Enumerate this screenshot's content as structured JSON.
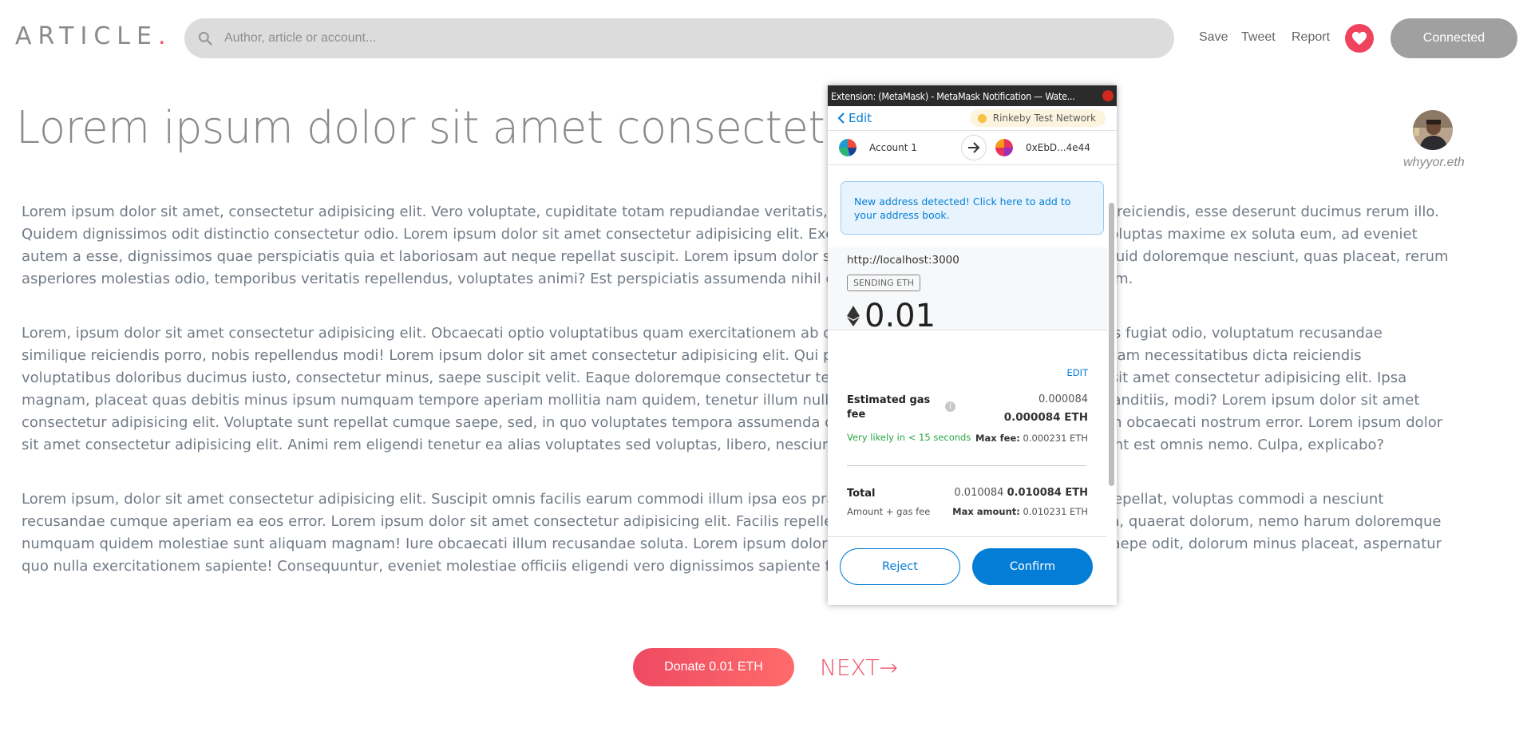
{
  "header": {
    "logo_text": "ARTICLE",
    "logo_dot": ".",
    "search_placeholder": "Author, article or account...",
    "nav": {
      "save": "Save",
      "tweet": "Tweet",
      "report": "Report"
    },
    "connected_label": "Connected"
  },
  "article": {
    "title": "Lorem ipsum dolor sit amet consectetur.",
    "author": "whyyor.eth",
    "paragraphs": [
      "Lorem ipsum dolor sit amet, consectetur adipisicing elit. Vero voluptate, cupiditate totam repudiandae veritatis, minima atque libero enim quae, dolore reiciendis, esse deserunt ducimus rerum illo. Quidem dignissimos odit distinctio consectetur odio. Lorem ipsum dolor sit amet consectetur adipisicing elit. Excepturi provident ipsam facere, nemo voluptas maxime ex soluta eum, ad eveniet autem a esse, dignissimos quae perspiciatis quia et laboriosam aut neque repellat suscipit. Lorem ipsum dolor sit amet consectetur adipisicing elit. Aliquid doloremque nesciunt, quas placeat, rerum asperiores molestias odio, temporibus veritatis repellendus, voluptates animi? Est perspiciatis assumenda nihil ducimus, quisquam sapiente totam ipsum.",
      "Lorem, ipsum dolor sit amet consectetur adipisicing elit. Obcaecati optio voluptatibus quam exercitationem ab quas itaque expedita cum nostrum. Quos fugiat odio, voluptatum recusandae similique reiciendis porro, nobis repellendus modi! Lorem ipsum dolor sit amet consectetur adipisicing elit. Qui pariatur explicabo tempora provident totam necessitatibus dicta reiciendis voluptatibus doloribus ducimus iusto, consectetur minus, saepe suscipit velit. Eaque doloremque consectetur temporibus incidunt? Lorem ipsum dolor sit amet consectetur adipisicing elit. Ipsa magnam, placeat quas debitis minus ipsum numquam tempore aperiam mollitia nam quidem, tenetur illum nulla officia nemo fugiat molestias quia? Blanditiis, modi? Lorem ipsum dolor sit amet consectetur adipisicing elit. Voluptate sunt repellat cumque saepe, sed, in quo voluptates tempora assumenda cum iure minus vero, dolorem at aliquam obcaecati nostrum error. Lorem ipsum dolor sit amet consectetur adipisicing elit. Animi rem eligendi tenetur ea alias voluptates sed voluptas, libero, nesciunt voluptate, nihil dolores quibusdam! Sint est omnis nemo. Culpa, explicabo?",
      "Lorem ipsum, dolor sit amet consectetur adipisicing elit. Suscipit omnis facilis earum commodi illum ipsa eos praesentium quibusdam accusamus quo repellat, voluptas commodi a nesciunt recusandae cumque aperiam ea eos error. Lorem ipsum dolor sit amet consectetur adipisicing elit. Facilis repellendus quasi ut voluptatem adipisci culpa, quaerat dolorum, nemo harum doloremque numquam quidem molestiae sunt aliquam magnam! Iure obcaecati illum recusandae soluta. Lorem ipsum dolor sit amet consectetur, adipisicing elit. Saepe odit, dolorum minus placeat, aspernatur quo nulla exercitationem sapiente! Consequuntur, eveniet molestiae officiis eligendi vero dignissimos sapiente facere aliquam."
    ],
    "donate_label": "Donate 0.01 ETH",
    "next_label": "NEXT→"
  },
  "metamask": {
    "window_title": "Extension: (MetaMask) - MetaMask Notification — Wate...",
    "edit_label": "Edit",
    "network": "Rinkeby Test Network",
    "from_account": "Account 1",
    "to_account": "0xEbD...4e44",
    "alert": "New address detected! Click here to add to your address book.",
    "origin": "http://localhost:3000",
    "badge": "SENDING ETH",
    "amount": "0.01",
    "edit_link": "EDIT",
    "gas_label": "Estimated gas fee",
    "gas_secondary": "0.000084",
    "gas_primary": "0.000084 ETH",
    "gas_likely": "Very likely in < 15 seconds",
    "max_fee_label": "Max fee:",
    "max_fee_value": "0.000231 ETH",
    "total_label": "Total",
    "total_secondary": "0.010084",
    "total_primary": "0.010084 ETH",
    "total_sub": "Amount + gas fee",
    "max_amount_label": "Max amount:",
    "max_amount_value": "0.010231 ETH",
    "reject_label": "Reject",
    "confirm_label": "Confirm"
  },
  "colors": {
    "accent": "#f0526a",
    "metamask_blue": "#037dd6",
    "connected_bg": "#a0a0a0"
  }
}
